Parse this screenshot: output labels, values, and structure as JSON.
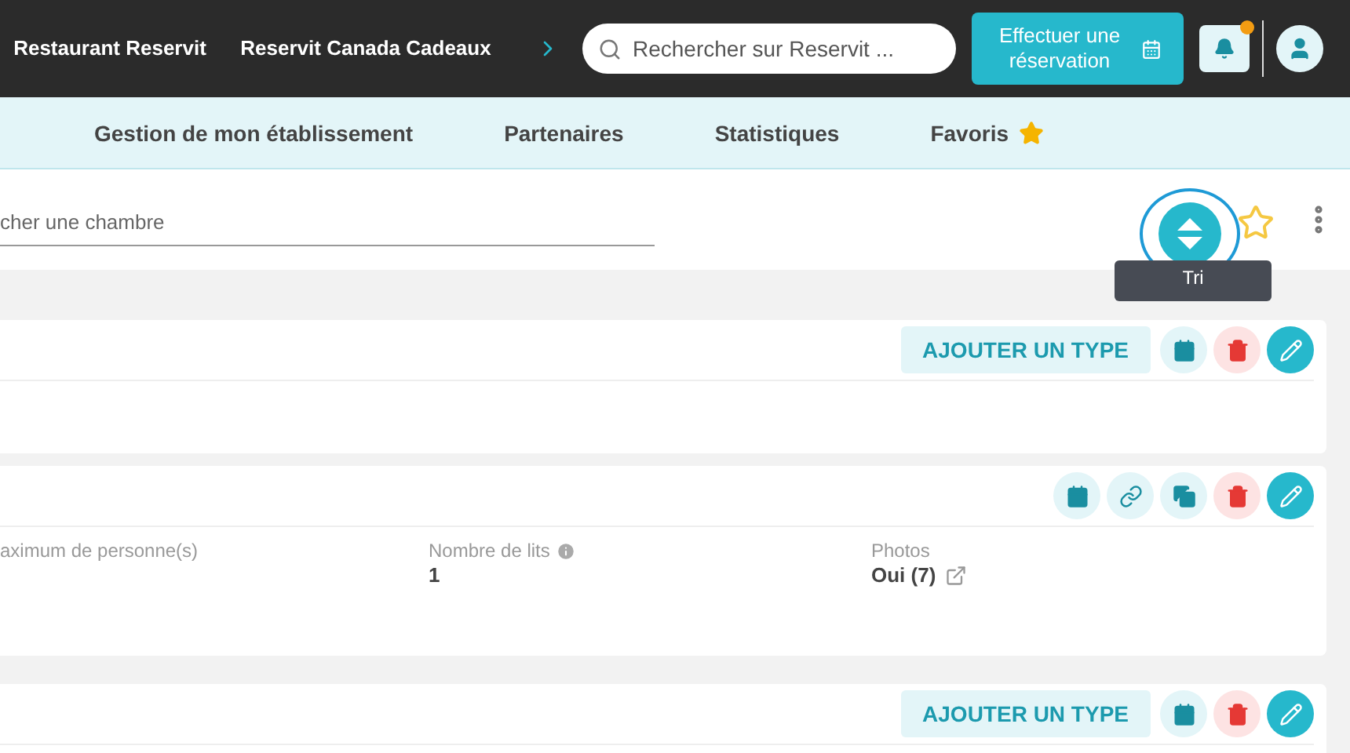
{
  "topbar": {
    "links": [
      "Restaurant Reservit",
      "Reservit Canada Cadeaux"
    ],
    "search": {
      "placeholder": "Rechercher sur Reservit ..."
    },
    "book_button": "Effectuer une réservation",
    "notification": true
  },
  "nav": [
    {
      "label": "Gestion de mon établissement",
      "favorite": false
    },
    {
      "label": "Partenaires",
      "favorite": false
    },
    {
      "label": "Statistiques",
      "favorite": false
    },
    {
      "label": "Favoris",
      "favorite": true
    }
  ],
  "toolbar": {
    "search": {
      "placeholder": "cher une chambre"
    },
    "tooltip": "Tri",
    "favorite": false
  },
  "cards": [
    {
      "actions": [
        {
          "kind": "add_type",
          "label": "AJOUTER UN TYPE"
        },
        {
          "kind": "calendar"
        },
        {
          "kind": "delete"
        },
        {
          "kind": "edit"
        }
      ]
    },
    {
      "actions": [
        {
          "kind": "calendar"
        },
        {
          "kind": "link"
        },
        {
          "kind": "copy"
        },
        {
          "kind": "delete"
        },
        {
          "kind": "edit"
        }
      ],
      "fields": [
        {
          "label": "aximum de personne(s)"
        },
        {
          "label": "Nombre de lits",
          "value": "1",
          "info": true
        },
        {
          "label": "Photos",
          "value": "Oui (7)",
          "external": true
        }
      ]
    },
    {
      "actions": [
        {
          "kind": "add_type",
          "label": "AJOUTER UN TYPE"
        },
        {
          "kind": "calendar"
        },
        {
          "kind": "delete"
        },
        {
          "kind": "edit"
        }
      ]
    }
  ]
}
